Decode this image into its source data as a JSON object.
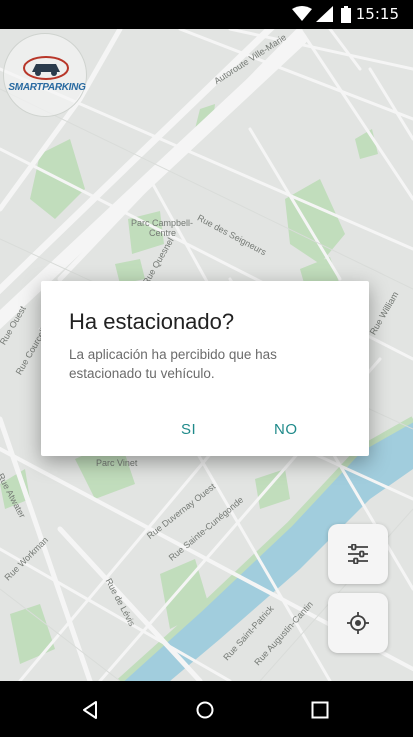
{
  "status_bar": {
    "time": "15:15"
  },
  "app": {
    "logo_text": "SMARTPARKING"
  },
  "map": {
    "labels": [
      {
        "text": "Autoroute Ville-Marie"
      },
      {
        "text": "Parc Campbell-"
      },
      {
        "text": "Centre"
      },
      {
        "text": "Rue des Seigneurs"
      },
      {
        "text": "Rue Quesnel"
      },
      {
        "text": "Rue Ouest"
      },
      {
        "text": "Rue Courcelle"
      },
      {
        "text": "Parc Vinet"
      },
      {
        "text": "Rue Duvernay Ouest"
      },
      {
        "text": "Rue Sainte-Cunégonde"
      },
      {
        "text": "Rue Atwater"
      },
      {
        "text": "Rue Workman"
      },
      {
        "text": "Rue de Lévis"
      },
      {
        "text": "Rue Saint-Patrick"
      },
      {
        "text": "Rue Augustin-Cantin"
      },
      {
        "text": "Rue William"
      }
    ]
  },
  "dialog": {
    "title": "Ha estacionado?",
    "message": "La aplicación ha percibido que has estacionado tu vehículo.",
    "yes_label": "SI",
    "no_label": "NO"
  },
  "colors": {
    "accent": "#1f8a8a",
    "park": "#c8e6c9",
    "water": "#9fd3e3"
  }
}
